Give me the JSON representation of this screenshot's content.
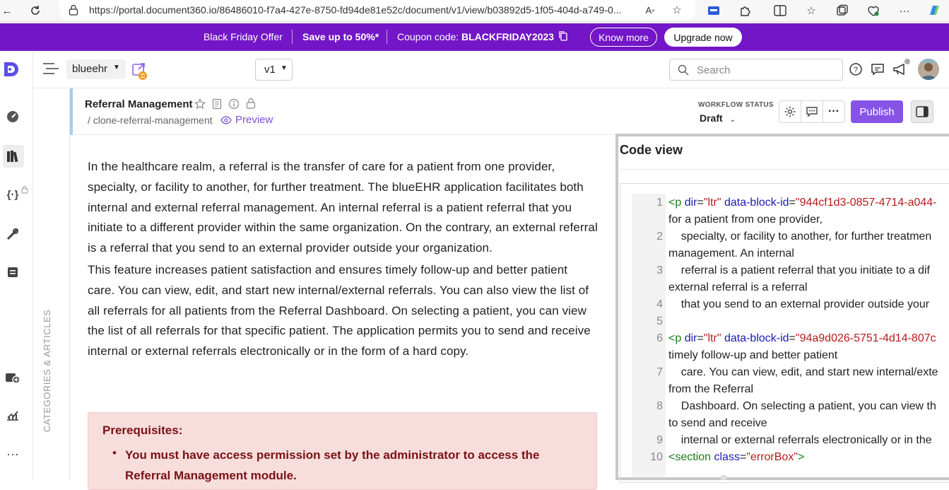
{
  "browser": {
    "url": "https://portal.document360.io/86486010-f7a4-427e-8750-fd94de81e52c/document/v1/view/b03892d5-1f05-404d-a749-0..."
  },
  "promo": {
    "offer": "Black Friday Offer",
    "save": "Save up to 50%*",
    "coupon_label": "Coupon code:",
    "coupon_code": "BLACKFRIDAY2023",
    "know_more": "Know more",
    "upgrade": "Upgrade now",
    "bg_color": "#7316c7"
  },
  "appbar": {
    "project": "blueehr",
    "version": "v1",
    "search_placeholder": "Search"
  },
  "sidebar": {
    "categories_label": "CATEGORIES & ARTICLES"
  },
  "article": {
    "title": "Referral Management",
    "slug": "/ clone-referral-management",
    "preview": "Preview",
    "workflow_label": "WORKFLOW STATUS",
    "workflow_value": "Draft",
    "publish": "Publish",
    "paragraphs": [
      "In the healthcare realm, a referral is the transfer of care for a patient from one provider, specialty, or facility to another, for further treatment. The blueEHR application facilitates both internal and external referral management. An internal referral is a patient referral that you initiate to a different provider within the same organization. On the contrary, an external referral is a referral that you send to an external provider outside your organization.",
      "This feature increases patient satisfaction and ensures timely follow-up and better patient care. You can view, edit, and start new internal/external referrals. You can also view the list of all referrals for all patients from the Referral Dashboard. On selecting a patient, you can view the list of all referrals for that specific patient. The application permits you to send and receive internal or external referrals electronically or in the form of a hard copy."
    ],
    "prereq_title": "Prerequisites:",
    "prereq_item": "You must have access permission set by the administrator to access the Referral Management module.",
    "accent_color": "#8753e6"
  },
  "code_view": {
    "title": "Code view",
    "lines": [
      {
        "n": "1",
        "tag_open": "<p ",
        "a1": "dir",
        "eq1": "=",
        "v1": "\"ltr\"",
        "a2": " data-block-id",
        "eq2": "=",
        "v2": "\"944cf1d3-0857-4714-a044-"
      },
      {
        "n": "",
        "text": "for a patient from one provider,"
      },
      {
        "n": "2",
        "text": "    specialty, or facility to another, for further treatmen"
      },
      {
        "n": "",
        "text": "management. An internal"
      },
      {
        "n": "3",
        "text": "    referral is a patient referral that you initiate to a dif"
      },
      {
        "n": "",
        "text": "external referral is a referral"
      },
      {
        "n": "4",
        "text": "    that you send to an external provider outside your "
      },
      {
        "n": "5",
        "text": ""
      },
      {
        "n": "6",
        "tag_open": "<p ",
        "a1": "dir",
        "eq1": "=",
        "v1": "\"ltr\"",
        "a2": " data-block-id",
        "eq2": "=",
        "v2": "\"94a9d026-5751-4d14-807c"
      },
      {
        "n": "",
        "text": "timely follow-up and better patient"
      },
      {
        "n": "7",
        "text": "    care. You can view, edit, and start new internal/exte"
      },
      {
        "n": "",
        "text": "from the Referral"
      },
      {
        "n": "8",
        "text": "    Dashboard. On selecting a patient, you can view th"
      },
      {
        "n": "",
        "text": "to send and receive"
      },
      {
        "n": "9",
        "text": "    internal or external referrals electronically or in the"
      },
      {
        "n": "10",
        "tag_open": "<section ",
        "a1": "class",
        "eq1": "=",
        "v1": "\"errorBox\"",
        "a2": "",
        "eq2": "",
        "v2": "",
        "tag_close": ">"
      }
    ]
  }
}
